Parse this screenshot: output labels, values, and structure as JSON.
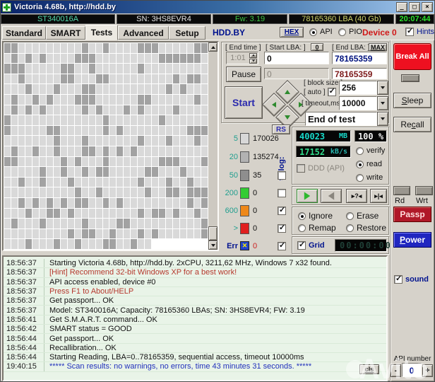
{
  "window": {
    "title": "Victoria 4.68b, http://hdd.by",
    "minimize": "_",
    "maximize": "□",
    "close": "×"
  },
  "info_bar": {
    "model": "ST340016A",
    "serial": "SN: 3HS8EVR4",
    "firmware": "Fw: 3.19",
    "capacity": "78165360 LBA (40 Gb)",
    "clock": "20:07:44"
  },
  "tabs": {
    "items": [
      "Standard",
      "SMART",
      "Tests",
      "Advanced",
      "Setup"
    ],
    "active": "Tests",
    "site": "HDD.BY",
    "hex": "HEX",
    "api": "API",
    "pio": "PIO",
    "device": "Device 0",
    "hints": "Hints"
  },
  "scan_grid": {
    "cols": 29,
    "rows": 20,
    "last_row_cells": 21,
    "dark_ratio": 0.26,
    "seed": 1337,
    "light_color": "#d9d9d9",
    "dark_color": "#a2a2a2"
  },
  "controls": {
    "end_time_label": "[ End time ]",
    "end_time_value": "1:01",
    "start_lba_label": "[ Start LBA: ]",
    "start_lba_button": "0",
    "start_lba_value": "0",
    "start_lba_current": "0",
    "end_lba_label": "[ End LBA: ]",
    "end_lba_button": "MAX",
    "end_lba_value": "78165359",
    "end_lba_current": "78165359",
    "pause": "Pause",
    "start": "Start",
    "block_size_label": "[ block size ]",
    "auto_label": "[ auto ]",
    "block_size_value": "256",
    "timeout_label": "[ timeout,ms ]",
    "timeout_value": "10000",
    "action_value": "End of test"
  },
  "timing": {
    "rs": "RS",
    "to_log": "to log:",
    "rows": [
      {
        "label": "5",
        "block": "#d8d8d8",
        "count": "170026"
      },
      {
        "label": "20",
        "block": "#b2b2b2",
        "count": "135274"
      },
      {
        "label": "50",
        "block": "#8e8e8e",
        "count": "35",
        "to_log": false
      },
      {
        "label": "200",
        "block": "#33cc33",
        "count": "0",
        "to_log": false
      },
      {
        "label": "600",
        "block": "#ee8819",
        "count": "0",
        "to_log": true
      },
      {
        "label": ">",
        "block": "#e02020",
        "count": "0",
        "to_log": true
      },
      {
        "label": "Err",
        "block": "err",
        "count": "0",
        "to_log": true,
        "count_color": "#cc2020"
      }
    ]
  },
  "readout": {
    "mb_value": "40023",
    "mb_unit": "MB",
    "percent": "100 %",
    "speed_value": "17152",
    "speed_unit": "kB/s",
    "ddd": "DDD (API)",
    "modes": [
      "verify",
      "read",
      "write"
    ],
    "mode_selected": "read"
  },
  "defect_actions": {
    "options": [
      "Ignore",
      "Erase",
      "Remap",
      "Restore"
    ],
    "selected": "Ignore"
  },
  "grid_toggle": {
    "label": "Grid",
    "checked": true,
    "timer": "00:00:00"
  },
  "sidebar": {
    "break_all": "Break All",
    "sleep": "Sleep",
    "recall": "Recall",
    "rd": "Rd",
    "wrt": "Wrt",
    "passp": "Passp",
    "power": "Power",
    "sound": "sound",
    "api_number_label": "API number",
    "minus": "-",
    "api_number": "0",
    "plus": "+"
  },
  "log": {
    "cls": "cls",
    "rows": [
      {
        "time": "18:56:37",
        "text": "Starting Victoria 4.68b, http://hdd.by. 2xCPU, 3211,62 MHz, Windows 7 x32 found.",
        "color": "normal"
      },
      {
        "time": "18:56:37",
        "text": "[Hint] Recommend 32-bit Windows XP for a best work!",
        "color": "red"
      },
      {
        "time": "18:56:37",
        "text": "API access enabled, device #0",
        "color": "normal"
      },
      {
        "time": "18:56:37",
        "text": "Press F1 to About/HELP",
        "color": "red"
      },
      {
        "time": "18:56:37",
        "text": "Get passport... OK",
        "color": "normal"
      },
      {
        "time": "18:56:37",
        "text": "Model: ST340016A; Capacity: 78165360 LBAs; SN: 3HS8EVR4; FW: 3.19",
        "color": "normal"
      },
      {
        "time": "18:56:41",
        "text": "Get S.M.A.R.T. command... OK",
        "color": "normal"
      },
      {
        "time": "18:56:42",
        "text": "SMART status = GOOD",
        "color": "normal"
      },
      {
        "time": "18:56:44",
        "text": "Get passport... OK",
        "color": "normal"
      },
      {
        "time": "18:56:44",
        "text": "Recallibration... OK",
        "color": "normal"
      },
      {
        "time": "18:56:44",
        "text": "Starting Reading, LBA=0..78165359, sequential access, timeout 10000ms",
        "color": "normal"
      },
      {
        "time": "19:40:15",
        "text": "***** Scan results: no warnings, no errors, time 43 minutes 31 seconds.  *****",
        "color": "blue"
      }
    ]
  },
  "watermark": "Avito"
}
